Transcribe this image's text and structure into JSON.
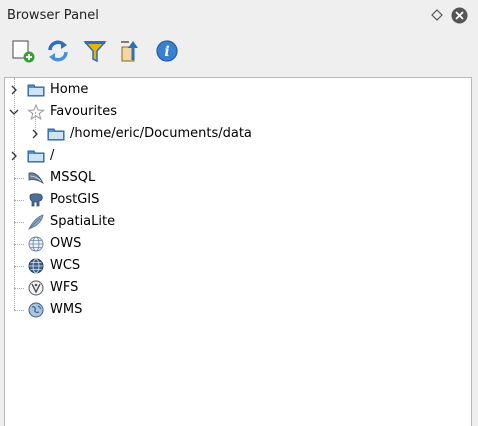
{
  "panel": {
    "title": "Browser Panel"
  },
  "toolbar": {
    "buttons": [
      {
        "name": "add-layer-icon"
      },
      {
        "name": "refresh-icon"
      },
      {
        "name": "filter-icon"
      },
      {
        "name": "collapse-all-icon"
      },
      {
        "name": "properties-icon"
      }
    ]
  },
  "tree": {
    "items": [
      {
        "label": "Home",
        "icon": "folder-icon",
        "expandable": true,
        "expanded": false
      },
      {
        "label": "Favourites",
        "icon": "star-icon",
        "expandable": true,
        "expanded": true
      },
      {
        "label": "/home/eric/Documents/data",
        "icon": "folder-icon",
        "expandable": true,
        "expanded": false
      },
      {
        "label": "/",
        "icon": "folder-icon",
        "expandable": true,
        "expanded": false
      },
      {
        "label": "MSSQL",
        "icon": "mssql-icon",
        "expandable": false
      },
      {
        "label": "PostGIS",
        "icon": "postgis-elephant-icon",
        "expandable": false
      },
      {
        "label": "SpatiaLite",
        "icon": "spatialite-feather-icon",
        "expandable": false
      },
      {
        "label": "OWS",
        "icon": "globe-icon",
        "expandable": false
      },
      {
        "label": "WCS",
        "icon": "wcs-globe-icon",
        "expandable": false
      },
      {
        "label": "WFS",
        "icon": "wfs-globe-icon",
        "expandable": false
      },
      {
        "label": "WMS",
        "icon": "wms-globe-icon",
        "expandable": false
      }
    ]
  },
  "colors": {
    "folder": "#4a90d9",
    "accent_blue": "#2a6fc0",
    "filter_yellow": "#e8b400",
    "close_dark": "#555555"
  }
}
